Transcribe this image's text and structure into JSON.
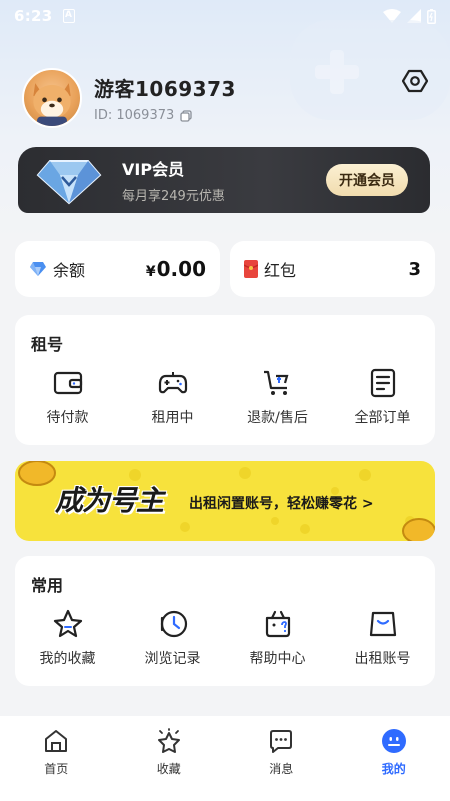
{
  "status": {
    "time": "6:23",
    "a_badge": "A"
  },
  "profile": {
    "name": "游客1069373",
    "id_text": "ID: 1069373"
  },
  "vip": {
    "title": "VIP会员",
    "subtitle": "每月享249元优惠",
    "button": "开通会员"
  },
  "wallet": {
    "balance_label": "余额",
    "balance_currency": "¥",
    "balance_value": "0.00",
    "redpack_label": "红包",
    "redpack_value": "3"
  },
  "rent": {
    "title": "租号",
    "items": [
      {
        "label": "待付款",
        "icon": "wallet-icon"
      },
      {
        "label": "租用中",
        "icon": "gamepad-icon"
      },
      {
        "label": "退款/售后",
        "icon": "cart-return-icon"
      },
      {
        "label": "全部订单",
        "icon": "orders-list-icon"
      }
    ]
  },
  "banner": {
    "title": "成为号主",
    "subtitle": "出租闲置账号，轻松赚零花 >"
  },
  "common": {
    "title": "常用",
    "items": [
      {
        "label": "我的收藏",
        "icon": "star-icon"
      },
      {
        "label": "浏览记录",
        "icon": "history-icon"
      },
      {
        "label": "帮助中心",
        "icon": "help-icon"
      },
      {
        "label": "出租账号",
        "icon": "shopping-bag-icon"
      }
    ]
  },
  "tabs": [
    {
      "label": "首页",
      "icon": "home-icon"
    },
    {
      "label": "收藏",
      "icon": "star-sparkle-icon"
    },
    {
      "label": "消息",
      "icon": "message-icon"
    },
    {
      "label": "我的",
      "icon": "profile-face-icon"
    }
  ],
  "colors": {
    "accent": "#2f6bff",
    "vip_bg": "#2c2d31",
    "banner_bg": "#f7e23c",
    "page_bg": "#f3f4f6"
  }
}
